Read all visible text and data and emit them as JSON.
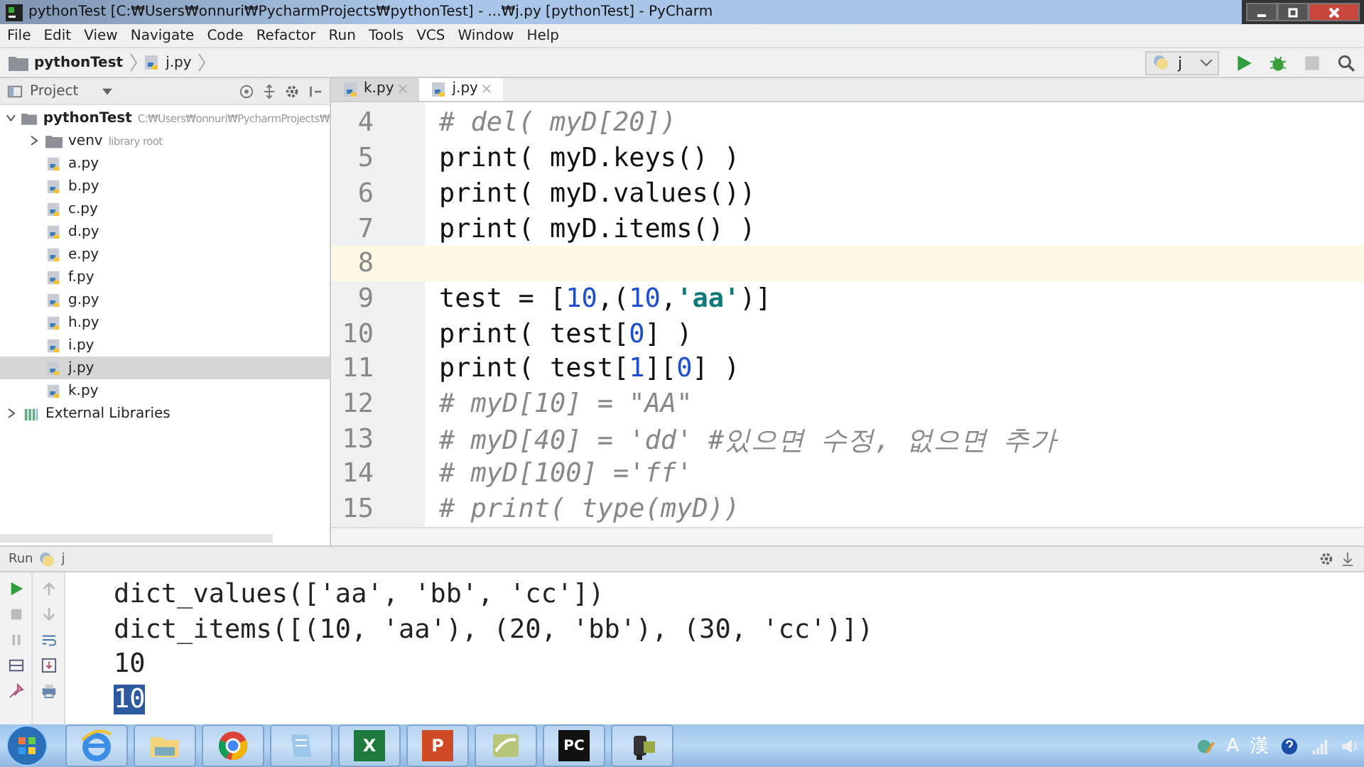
{
  "window": {
    "title": "pythonTest [C:₩Users₩onnuri₩PycharmProjects₩pythonTest] - ...₩j.py [pythonTest] - PyCharm"
  },
  "menu": [
    "File",
    "Edit",
    "View",
    "Navigate",
    "Code",
    "Refactor",
    "Run",
    "Tools",
    "VCS",
    "Window",
    "Help"
  ],
  "breadcrumb": [
    "pythonTest",
    "j.py"
  ],
  "run_config": {
    "value": "j"
  },
  "project_panel": {
    "title": "Project",
    "tree": [
      {
        "label": "pythonTest",
        "hint": "C:₩Users₩onnuri₩PycharmProjects₩",
        "kind": "folder",
        "expanded": true,
        "selected": false,
        "children": [
          {
            "label": "venv",
            "hint": "library root",
            "kind": "folder",
            "expanded": false,
            "selected": false
          },
          {
            "label": "a.py",
            "kind": "file",
            "selected": false
          },
          {
            "label": "b.py",
            "kind": "file",
            "selected": false
          },
          {
            "label": "c.py",
            "kind": "file",
            "selected": false
          },
          {
            "label": "d.py",
            "kind": "file",
            "selected": false
          },
          {
            "label": "e.py",
            "kind": "file",
            "selected": false
          },
          {
            "label": "f.py",
            "kind": "file",
            "selected": false
          },
          {
            "label": "g.py",
            "kind": "file",
            "selected": false
          },
          {
            "label": "h.py",
            "kind": "file",
            "selected": false
          },
          {
            "label": "i.py",
            "kind": "file",
            "selected": false
          },
          {
            "label": "j.py",
            "kind": "file",
            "selected": true
          },
          {
            "label": "k.py",
            "kind": "file",
            "selected": false
          }
        ]
      },
      {
        "label": "External Libraries",
        "kind": "library",
        "expanded": false,
        "selected": false
      }
    ]
  },
  "editor_tabs": [
    {
      "label": "k.py",
      "selected": false
    },
    {
      "label": "j.py",
      "selected": true
    }
  ],
  "code_lines": [
    {
      "number": "4",
      "current": false,
      "segments": [
        {
          "kind": "comment",
          "text": "# del( myD[20])"
        }
      ]
    },
    {
      "number": "5",
      "current": false,
      "segments": [
        {
          "kind": "text",
          "text": "print( myD.keys() )"
        }
      ]
    },
    {
      "number": "6",
      "current": false,
      "segments": [
        {
          "kind": "text",
          "text": "print( myD.values())"
        }
      ]
    },
    {
      "number": "7",
      "current": false,
      "segments": [
        {
          "kind": "text",
          "text": "print( myD.items() )"
        }
      ]
    },
    {
      "number": "8",
      "current": true
    },
    {
      "number": "9",
      "current": false,
      "segments": [
        {
          "kind": "text",
          "text": "test = ["
        },
        {
          "kind": "number",
          "text": "10"
        },
        {
          "kind": "text",
          "text": ",("
        },
        {
          "kind": "number",
          "text": "10"
        },
        {
          "kind": "text",
          "text": ","
        },
        {
          "kind": "string",
          "text": "'aa'"
        },
        {
          "kind": "text",
          "text": ")]"
        }
      ]
    },
    {
      "number": "10",
      "current": false,
      "segments": [
        {
          "kind": "text",
          "text": "print( test["
        },
        {
          "kind": "number",
          "text": "0"
        },
        {
          "kind": "text",
          "text": "] )"
        }
      ]
    },
    {
      "number": "11",
      "current": false,
      "segments": [
        {
          "kind": "text",
          "text": "print( test["
        },
        {
          "kind": "number",
          "text": "1"
        },
        {
          "kind": "text",
          "text": "]["
        },
        {
          "kind": "number",
          "text": "0"
        },
        {
          "kind": "text",
          "text": "] )"
        }
      ]
    },
    {
      "number": "12",
      "current": false,
      "segments": [
        {
          "kind": "comment",
          "text": "# myD[10] = \"AA\""
        }
      ]
    },
    {
      "number": "13",
      "current": false,
      "segments": [
        {
          "kind": "comment",
          "text": "# myD[40] = 'dd' #있으면 수정, 없으면 추가"
        }
      ]
    },
    {
      "number": "14",
      "current": false,
      "segments": [
        {
          "kind": "comment",
          "text": "# myD[100] ='ff'"
        }
      ]
    },
    {
      "number": "15",
      "current": false,
      "segments": [
        {
          "kind": "comment",
          "text": "# print( type(myD))"
        }
      ]
    }
  ],
  "run_panel": {
    "title": "Run",
    "config": "j",
    "output": [
      {
        "text": "dict_values(['aa', 'bb', 'cc'])",
        "selected": false
      },
      {
        "text": "dict_items([(10, 'aa'), (20, 'bb'), (30, 'cc')])",
        "selected": false
      },
      {
        "text": "10",
        "selected": false
      },
      {
        "text": "10",
        "selected": true
      }
    ]
  },
  "taskbar": {
    "apps": [
      {
        "kind": "ie"
      },
      {
        "kind": "folder"
      },
      {
        "kind": "chrome"
      },
      {
        "kind": "notepad"
      },
      {
        "kind": "excel",
        "label": "X"
      },
      {
        "kind": "powerpoint",
        "label": "P"
      },
      {
        "kind": "green"
      },
      {
        "kind": "pycharm",
        "label": "PC"
      },
      {
        "kind": "camera"
      }
    ],
    "tray": [
      "A",
      "漢"
    ]
  }
}
